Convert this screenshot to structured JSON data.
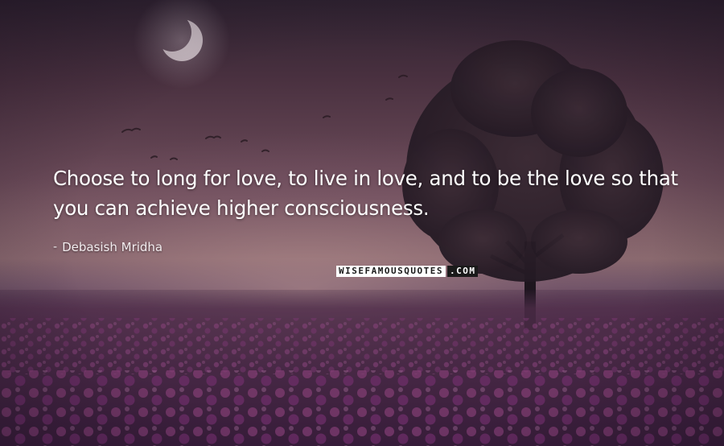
{
  "quote": {
    "text": "Choose to long for love, to live in love, and to be the love so that you can achieve higher consciousness.",
    "author": "Debasish Mridha"
  },
  "attribution": {
    "dash": "-",
    "brand_part_1": "WISEFAMOUSQUOTES",
    "brand_part_2": ".COM"
  },
  "scene": {
    "elements": [
      "moon",
      "birds",
      "tree",
      "flower-field"
    ],
    "colors": {
      "sky_top": "#2e2230",
      "horizon_glow": "#8a6a6e",
      "field": "#4a2a48",
      "flowers": "#a04f8e",
      "tree": "#241a24"
    }
  }
}
